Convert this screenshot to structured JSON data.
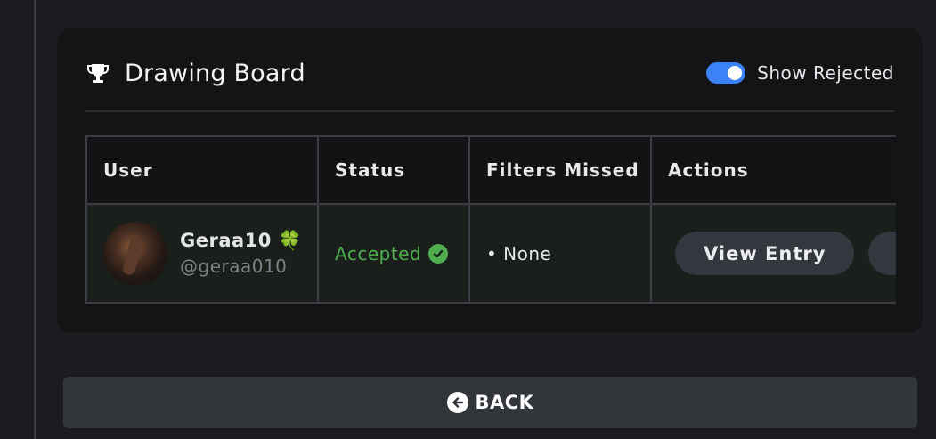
{
  "card": {
    "title": "Drawing Board",
    "title_icon": "trophy-icon",
    "toggle": {
      "label": "Show Rejected",
      "on": true,
      "accent": "#3b82f6"
    }
  },
  "table": {
    "headers": [
      "User",
      "Status",
      "Filters Missed",
      "Actions"
    ],
    "rows": [
      {
        "user_name": "Geraa10 🍀",
        "user_handle": "@geraa010",
        "status": "Accepted",
        "status_color": "#4fae4f",
        "filters_missed": "• None",
        "action_primary": "View Entry"
      }
    ]
  },
  "footer": {
    "back_label": "BACK",
    "back_icon": "arrow-left-circle-icon"
  }
}
